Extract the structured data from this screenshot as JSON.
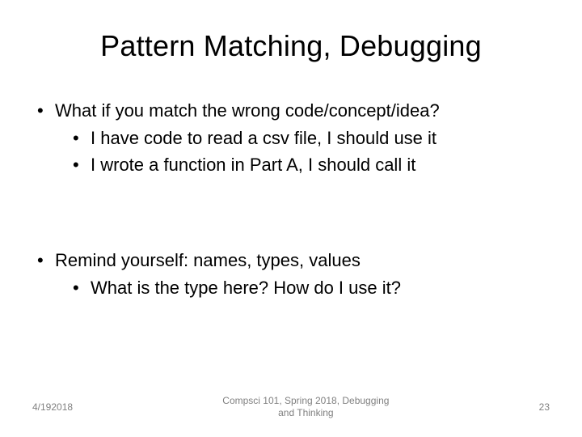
{
  "title": "Pattern Matching, Debugging",
  "blocks": [
    {
      "text": "What if you match the wrong code/concept/idea?",
      "sub": [
        "I have code to read a csv file, I should use it",
        "I wrote a function in Part A, I should call it"
      ]
    },
    {
      "text": "Remind yourself: names, types, values",
      "sub": [
        "What is the type here? How do I use it?"
      ]
    }
  ],
  "footer": {
    "date": "4/192018",
    "center_line1": "Compsci 101, Spring 2018, Debugging",
    "center_line2": "and Thinking",
    "page": "23"
  }
}
